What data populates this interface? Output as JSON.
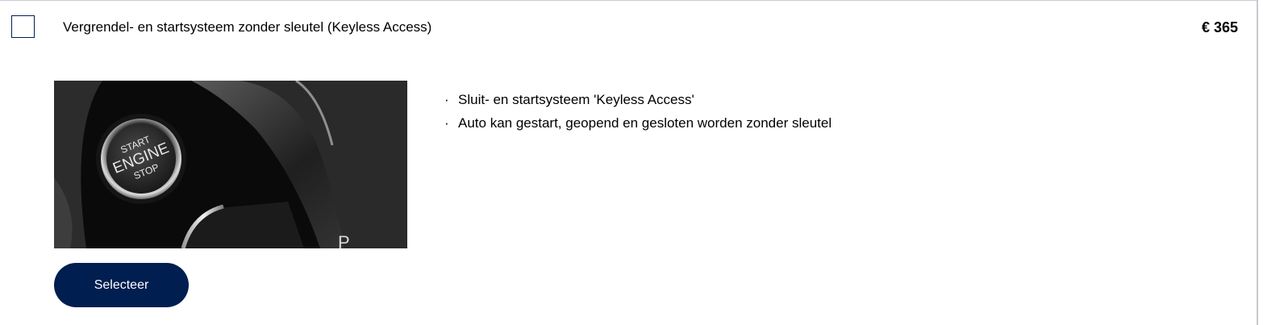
{
  "option": {
    "title": "Vergrendel- en startsysteem zonder sleutel (Keyless Access)",
    "price": "€ 365",
    "checked": false,
    "image": {
      "icon": "start-engine-stop-button-photo",
      "button_text_lines": [
        "START",
        "ENGINE",
        "STOP"
      ],
      "gear_letter": "P"
    },
    "features": [
      "Sluit- en startsysteem 'Keyless Access'",
      "Auto kan gestart, geopend en gesloten worden zonder sleutel"
    ],
    "bullet_char": "·",
    "select_label": "Selecteer"
  },
  "colors": {
    "primary": "#001e50",
    "border": "#c7cbd1",
    "text": "#000000"
  }
}
